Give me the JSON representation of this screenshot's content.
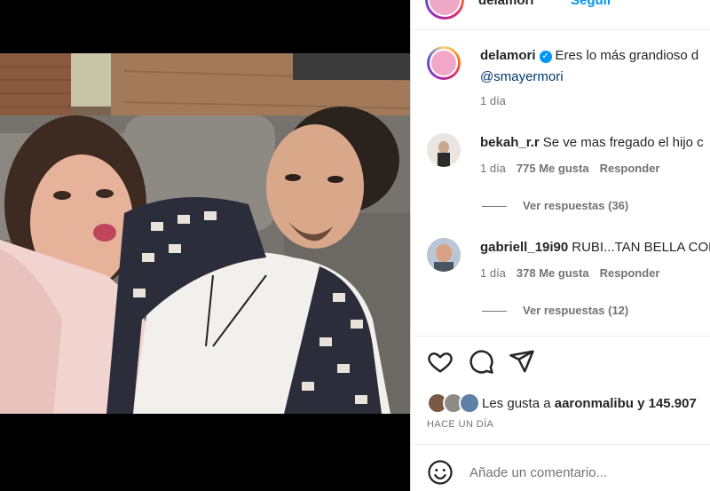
{
  "header": {
    "username": "delamori",
    "follow_label": "Seguir"
  },
  "caption": {
    "username": "delamori",
    "text": "Eres lo más grandioso d",
    "mention": "@smayermori",
    "time": "1 día"
  },
  "comments": [
    {
      "username": "bekah_r.r",
      "text": "Se ve mas fregado el hijo c",
      "time": "1 día",
      "likes": "775 Me gusta",
      "reply_label": "Responder",
      "replies_label": "Ver respuestas (36)"
    },
    {
      "username": "gabriell_19i90",
      "text": "RUBI...TAN BELLA COM",
      "time": "1 día",
      "likes": "378 Me gusta",
      "reply_label": "Responder",
      "replies_label": "Ver respuestas (12)"
    }
  ],
  "likes_summary": {
    "prefix": "Les gusta a",
    "user": "aaronmalibu",
    "suffix": "y 145.907"
  },
  "timestamp": "HACE UN DÍA",
  "comment_box": {
    "placeholder": "Añade un comentario..."
  },
  "icons": {
    "like": "heart-icon",
    "comment": "comment-bubble-icon",
    "share": "paper-plane-icon",
    "emoji": "smiley-icon",
    "verified": "verified-badge-icon"
  },
  "colors": {
    "link_blue": "#0095f6",
    "mention": "#00376b",
    "muted_text": "#737373"
  }
}
